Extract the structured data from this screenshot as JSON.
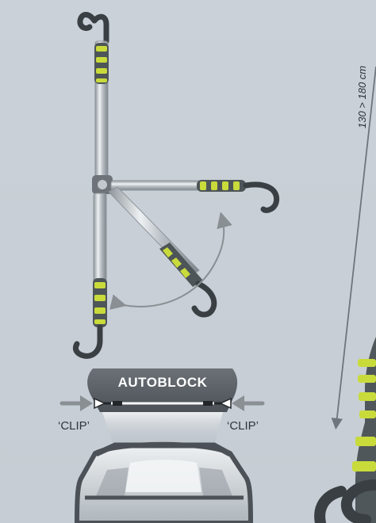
{
  "product": {
    "badge_label": "AUTOBLOCK",
    "clip_left_label": "‘CLIP’",
    "clip_right_label": "‘CLIP’",
    "height_range_label": "130 > 180 cm"
  },
  "colors": {
    "background": "#c9d0d7",
    "pole": "#b8bec4",
    "pole_shadow": "#8e959b",
    "grip_dark": "#4e5558",
    "grip_lime": "#c8db3b",
    "hook": "#3a3f43",
    "arrow": "#8a8f94",
    "badge": "#5d6368",
    "text": "#30363b"
  },
  "icons": {
    "rotation_arrow": "rotation-arrow-icon",
    "clip_arrow_left": "arrow-right-icon",
    "clip_arrow_right": "arrow-left-icon",
    "measure_arrow": "double-arrow-icon"
  }
}
